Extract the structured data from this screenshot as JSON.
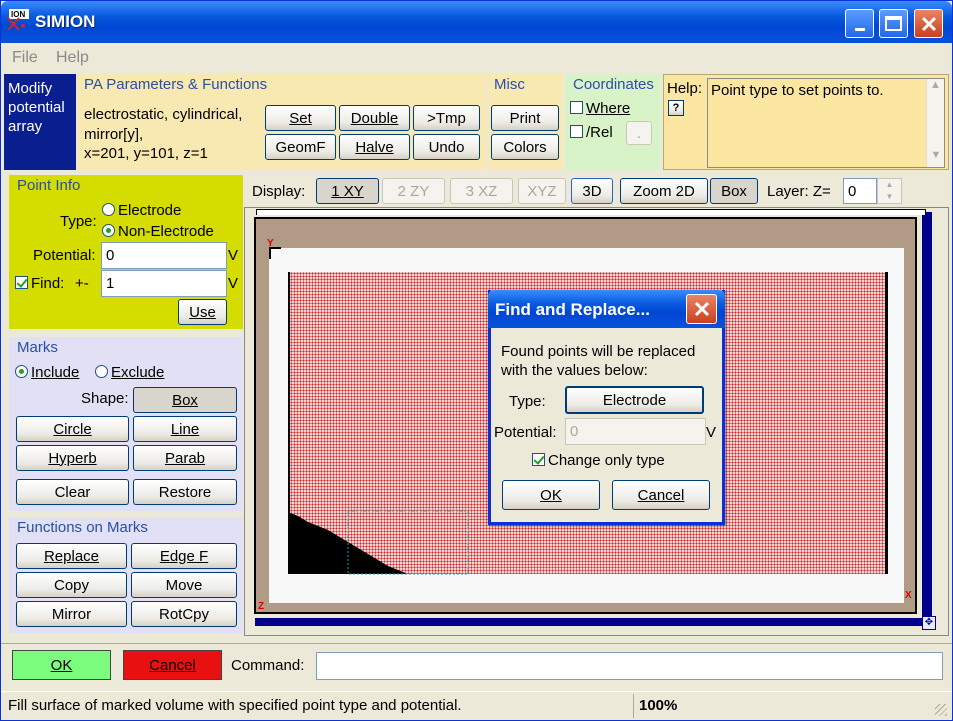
{
  "window": {
    "title": "SIMION"
  },
  "menu": {
    "file": "File",
    "help": "Help"
  },
  "mode": {
    "line1": "Modify",
    "line2": "potential",
    "line3": "array"
  },
  "pa": {
    "title": "PA Parameters & Functions",
    "line1": "electrostatic, cylindrical,",
    "line2": "mirror[y],",
    "line3": "x=201, y=101, z=1",
    "set": "Set",
    "double": "Double",
    "tmp": ">Tmp",
    "geomf": "GeomF",
    "halve": "Halve",
    "undo": "Undo"
  },
  "misc": {
    "title": "Misc",
    "print": "Print",
    "colors": "Colors"
  },
  "coords": {
    "title": "Coordinates",
    "where": "Where",
    "rel": "/Rel",
    "btn": "."
  },
  "help": {
    "label": "Help:",
    "q": "?",
    "text": "Point type to set points to."
  },
  "point_info": {
    "title": "Point Info",
    "type_label": "Type:",
    "electrode": "Electrode",
    "non_electrode": "Non-Electrode",
    "potential_label": "Potential:",
    "potential_value": "0",
    "unit": "V",
    "find_label": "Find:",
    "pm": "+-",
    "find_value": "1",
    "find_unit": "V",
    "use": "Use"
  },
  "marks": {
    "title": "Marks",
    "include": "Include",
    "exclude": "Exclude",
    "shape_label": "Shape:",
    "box": "Box",
    "circle": "Circle",
    "line": "Line",
    "hyperb": "Hyperb",
    "parab": "Parab",
    "clear": "Clear",
    "restore": "Restore"
  },
  "functions": {
    "title": "Functions on Marks",
    "replace": "Replace",
    "edgef": "Edge F",
    "copy": "Copy",
    "move": "Move",
    "mirror": "Mirror",
    "rotcpy": "RotCpy"
  },
  "display": {
    "label": "Display:",
    "xy": "1 XY",
    "zy": "2 ZY",
    "xz": "3 XZ",
    "xyz": "XYZ",
    "d3": "3D",
    "zoom": "Zoom 2D",
    "box": "Box",
    "layer_label": "Layer: Z=",
    "layer_value": "0"
  },
  "view": {
    "y_axis": "Y",
    "x_axis": "X",
    "z_axis": "Z"
  },
  "dialog": {
    "title": "Find and Replace...",
    "msg1": "Found points will be replaced",
    "msg2": "with the values below:",
    "type_label": "Type:",
    "type_value": "Electrode",
    "potential_label": "Potential:",
    "potential_value": "0",
    "unit": "V",
    "change_only": "Change only type",
    "ok": "OK",
    "cancel": "Cancel"
  },
  "bottom": {
    "ok": "OK",
    "cancel": "Cancel",
    "command_label": "Command:",
    "command_value": ""
  },
  "status": {
    "text": "Fill surface of marked volume with specified point type and potential.",
    "zoom": "100%"
  },
  "colors": {
    "title_blue": "#0a52d9",
    "mode_bg": "#0a1f8f",
    "pa_bg": "#f8e8b2",
    "coords_bg": "#d9f3c8",
    "help_bg": "#fbe6a2",
    "point_info_bg": "#d4dc00",
    "marks_bg": "#e1e0f4",
    "view_border": "#b29b86",
    "grid_red": "#cc2020",
    "ok_green": "#7cfc7c",
    "cancel_red": "#e81010"
  }
}
